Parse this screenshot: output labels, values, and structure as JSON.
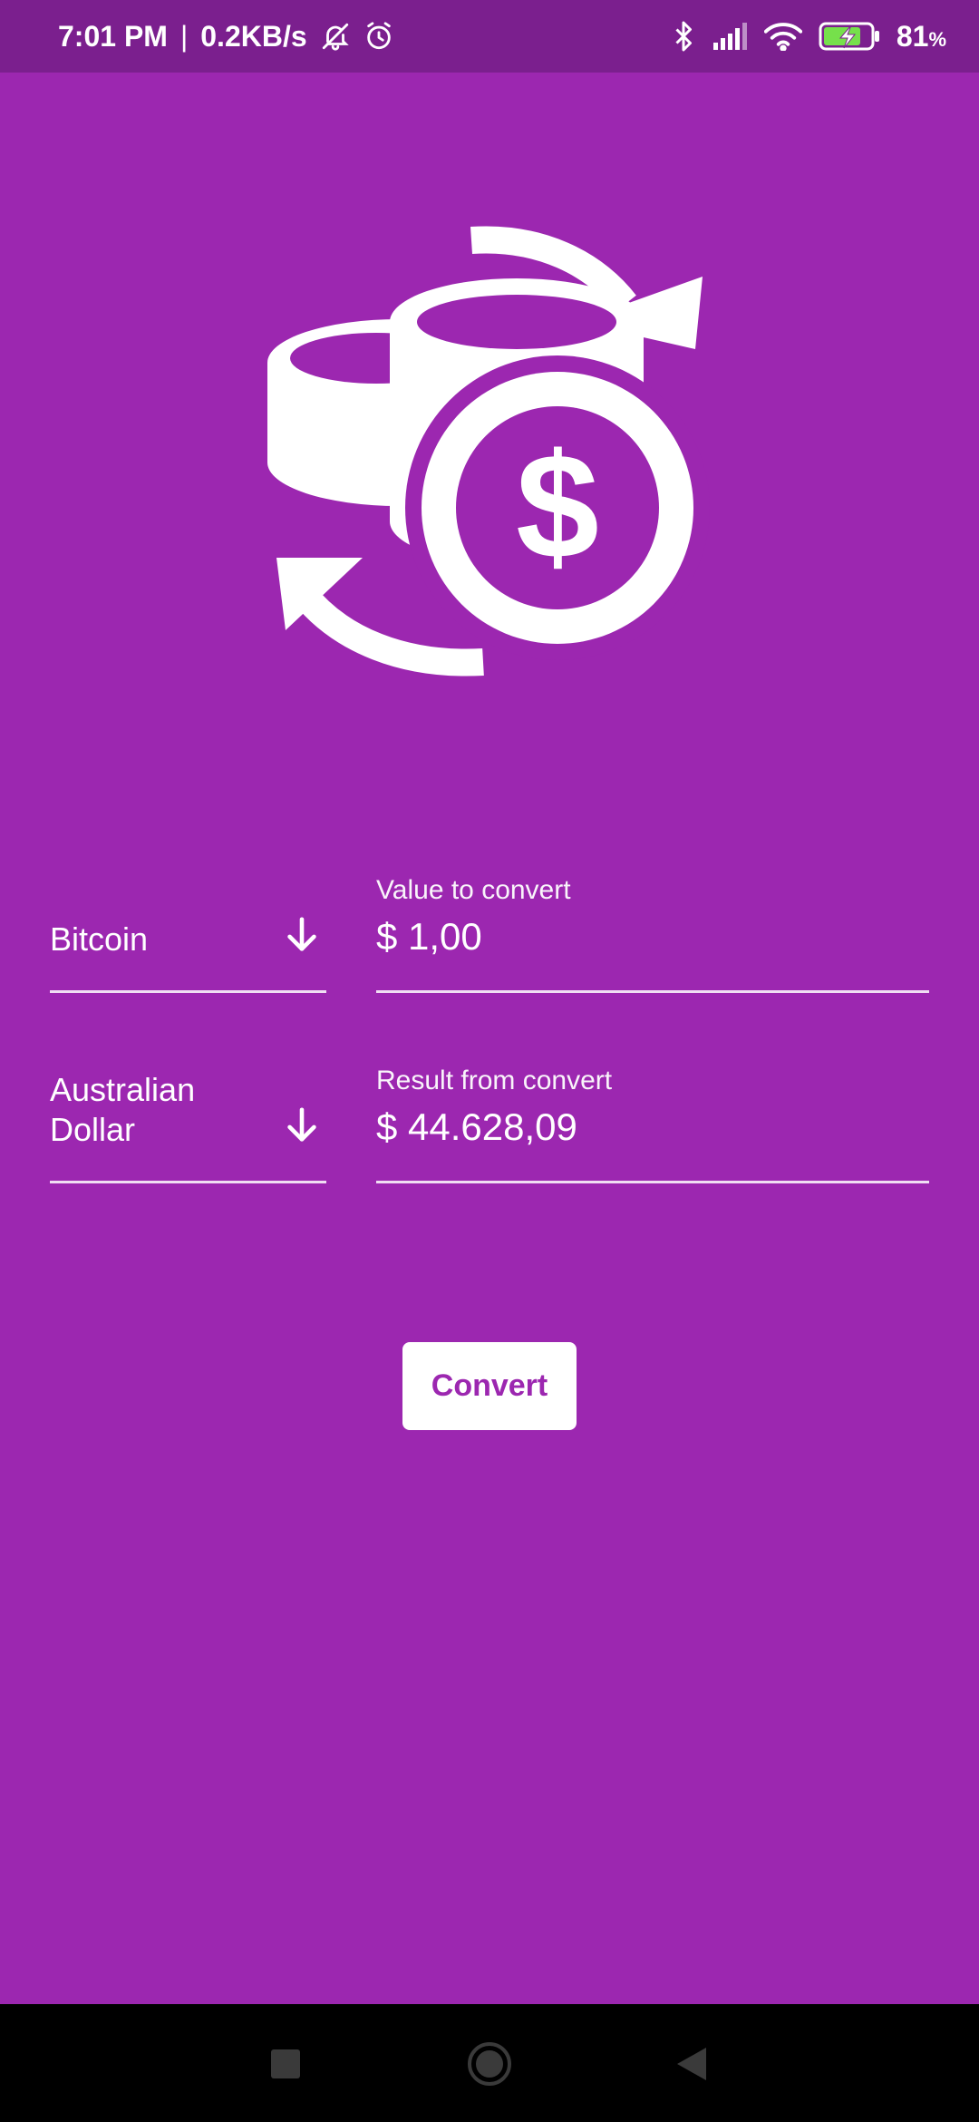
{
  "status_bar": {
    "time": "7:01 PM",
    "separator": "|",
    "net_speed": "0.2KB/s",
    "battery_percent": "81",
    "battery_unit": "%",
    "icons": [
      "bell-muted-icon",
      "alarm-icon",
      "bluetooth-icon",
      "signal-icon",
      "wifi-icon",
      "battery-charging-icon"
    ]
  },
  "hero": {
    "icon": "currency-exchange-coins-icon"
  },
  "from": {
    "currency": "Bitcoin",
    "arrow_icon": "arrow-down-icon",
    "value_label": "Value to convert",
    "value": "$ 1,00"
  },
  "to": {
    "currency": "Australian Dollar",
    "arrow_icon": "arrow-down-icon",
    "result_label": "Result from convert",
    "result": "$ 44.628,09"
  },
  "convert_button": {
    "label": "Convert"
  },
  "nav": {
    "icons": [
      "recent-apps-icon",
      "home-icon",
      "back-icon"
    ]
  },
  "colors": {
    "background": "#9c27b0",
    "status_bar": "#7b1f8e",
    "button_text": "#9c27b0",
    "nav_bar": "#000000"
  }
}
